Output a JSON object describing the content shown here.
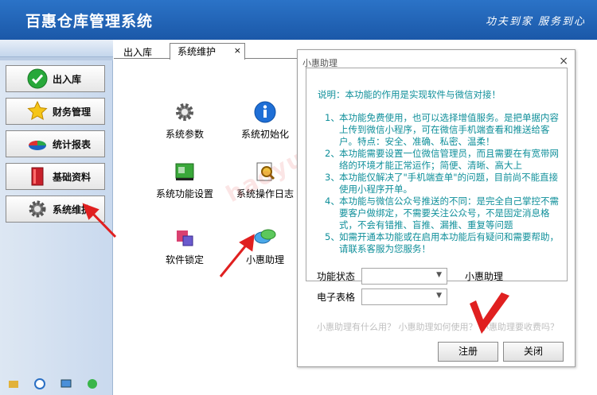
{
  "header": {
    "title": "百惠仓库管理系统",
    "slogan": "功夫到家 服务到心"
  },
  "sidebar": {
    "items": [
      {
        "label": "出入库",
        "icon": "check-icon"
      },
      {
        "label": "财务管理",
        "icon": "star-icon"
      },
      {
        "label": "统计报表",
        "icon": "pie-chart-icon"
      },
      {
        "label": "基础资料",
        "icon": "book-icon"
      },
      {
        "label": "系统维护",
        "icon": "gear-icon"
      }
    ]
  },
  "tabs": [
    {
      "label": "出入库"
    },
    {
      "label": "系统维护",
      "close": "×"
    }
  ],
  "tools": [
    {
      "label": "系统参数"
    },
    {
      "label": "系统初始化"
    },
    {
      "label": "系统功能设置"
    },
    {
      "label": "系统操作日志"
    },
    {
      "label": "软件锁定"
    },
    {
      "label": "小惠助理"
    }
  ],
  "watermark": "haoyu",
  "dialog": {
    "title": "小惠助理",
    "close": "×",
    "description": "说明：本功能的作用是实现软件与微信对接！",
    "points": [
      {
        "num": "1、",
        "text": "本功能免费使用，也可以选择增值服务。是把单据内容上传到微信小程序，可在微信手机端查看和推送给客户。特点：安全、准确、私密、温柔！"
      },
      {
        "num": "2、",
        "text": "本功能需要设置一位微信管理员，而且需要在有宽带网络的环境才能正常运作；简便、清晰、高大上"
      },
      {
        "num": "3、",
        "text": "本功能仅解决了\"手机端查单\"的问题，目前尚不能直接使用小程序开单。"
      },
      {
        "num": "4、",
        "text": "本功能与微信公众号推送的不同：是完全自己掌控不需要客户做绑定，不需要关注公众号，不是固定消息格式，不会有错推、盲推、漏推、重复等问题"
      },
      {
        "num": "5、",
        "text": "如需开通本功能或在启用本功能后有疑问和需要帮助，请联系客服为您服务！"
      }
    ],
    "fields": [
      {
        "label": "功能状态",
        "value": "",
        "status": "小惠助理"
      },
      {
        "label": "电子表格",
        "value": "",
        "status": ""
      }
    ],
    "links": "小惠助理有什么用？ 小惠助理如何使用？ 小惠助理要收费吗？",
    "buttons": {
      "register": "注册",
      "close": "关闭"
    }
  },
  "colors": {
    "header": "#1f61b3",
    "dialog_text": "#0f8f9a",
    "arrow": "#e02020"
  }
}
